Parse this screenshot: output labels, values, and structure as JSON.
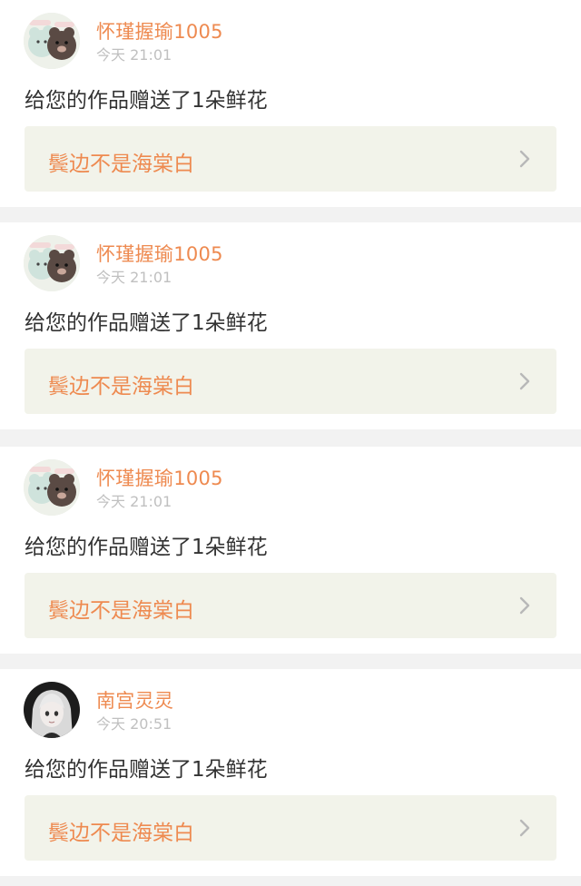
{
  "notifications": [
    {
      "user": "怀瑾握瑜1005",
      "time": "今天 21:01",
      "message": "给您的作品赠送了1朵鲜花",
      "work_title": "鬓边不是海棠白",
      "avatar": "cartoon-bears-avatar"
    },
    {
      "user": "怀瑾握瑜1005",
      "time": "今天 21:01",
      "message": "给您的作品赠送了1朵鲜花",
      "work_title": "鬓边不是海棠白",
      "avatar": "cartoon-bears-avatar"
    },
    {
      "user": "怀瑾握瑜1005",
      "time": "今天 21:01",
      "message": "给您的作品赠送了1朵鲜花",
      "work_title": "鬓边不是海棠白",
      "avatar": "cartoon-bears-avatar"
    },
    {
      "user": "南宫灵灵",
      "time": "今天 20:51",
      "message": "给您的作品赠送了1朵鲜花",
      "work_title": "鬓边不是海棠白",
      "avatar": "anime-girl-avatar"
    }
  ],
  "colors": {
    "accent": "#ee8a50",
    "link_bg": "#f2f3ea",
    "separator": "#f2f2f2",
    "muted_text": "#c0c0c0",
    "body_text": "#333333"
  }
}
